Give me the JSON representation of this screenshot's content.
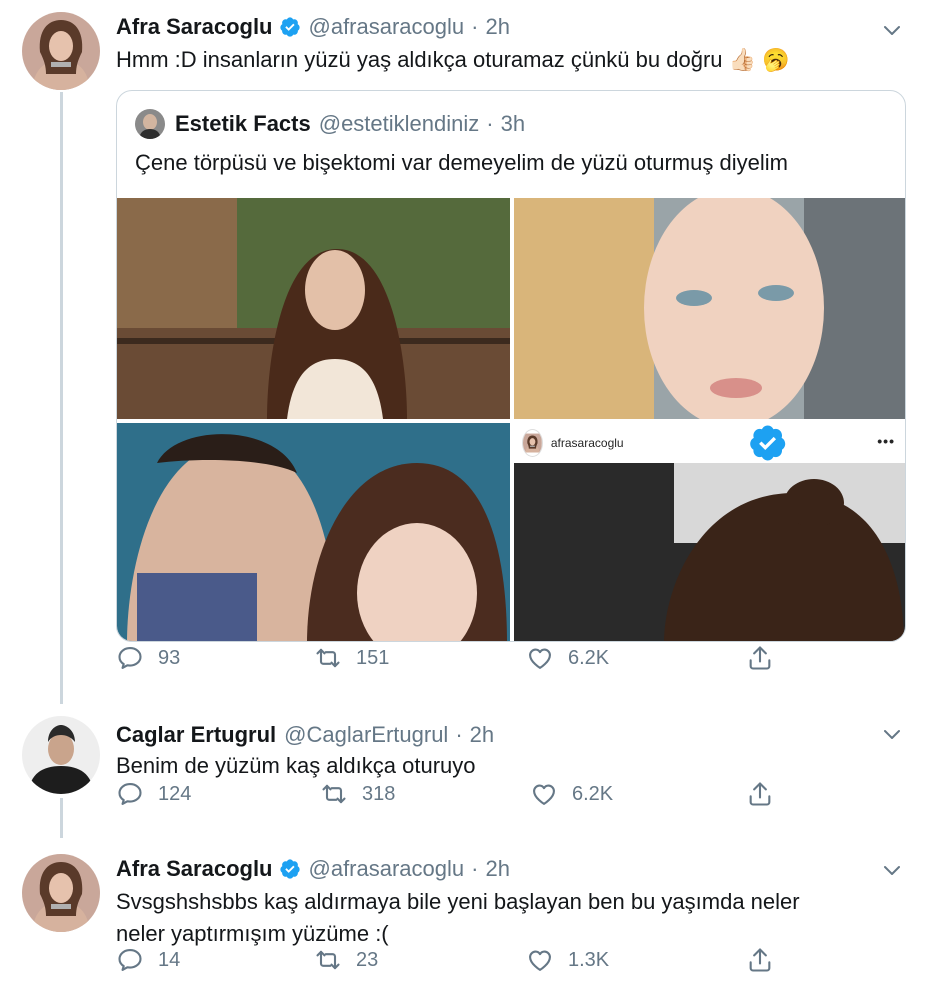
{
  "colors": {
    "verified": "#1da1f2",
    "secondary": "#657786",
    "border": "#ccd6dd"
  },
  "tweets": [
    {
      "name": "Afra Saracoglu",
      "handle": "@afrasaracoglu",
      "separator": "·",
      "time": "2h",
      "text": "Hmm :D insanların yüzü yaş aldıkça oturamaz çünkü bu doğru 👍🏻 🥱",
      "replies": "93",
      "retweets": "151",
      "likes": "6.2K",
      "quote": {
        "name": "Estetik Facts",
        "handle": "@estetiklendiniz",
        "separator": "·",
        "time": "3h",
        "text": "Çene törpüsü ve bişektomi var demeyelim de yüzü oturmuş diyelim",
        "instagram_username": "afrasaracoglu",
        "instagram_more": "•••"
      }
    },
    {
      "name": "Caglar Ertugrul",
      "handle": "@CaglarErtugrul",
      "separator": "·",
      "time": "2h",
      "text": "Benim de yüzüm kaş aldıkça oturuyo",
      "replies": "124",
      "retweets": "318",
      "likes": "6.2K"
    },
    {
      "name": "Afra Saracoglu",
      "handle": "@afrasaracoglu",
      "separator": "·",
      "time": "2h",
      "text_line1": "Svsgshshsbbs kaş aldırmaya bile yeni başlayan ben bu yaşımda neler",
      "text_line2": "neler yaptırmışım yüzüme :(",
      "replies": "14",
      "retweets": "23",
      "likes": "1.3K"
    }
  ]
}
